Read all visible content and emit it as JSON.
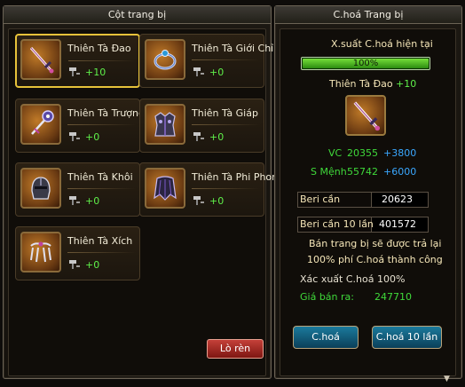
{
  "left_panel": {
    "title": "Cột trang bị",
    "slots": [
      {
        "name": "Thiên Tà Đao",
        "level": "+10",
        "icon": "saber-icon",
        "selected": true
      },
      {
        "name": "Thiên Tà Giới Chỉ",
        "level": "+0",
        "icon": "ring-icon",
        "selected": false
      },
      {
        "name": "Thiên Tà Trượng",
        "level": "+0",
        "icon": "staff-icon",
        "selected": false
      },
      {
        "name": "Thiên Tà Giáp",
        "level": "+0",
        "icon": "armor-icon",
        "selected": false
      },
      {
        "name": "Thiên Tà Khôi",
        "level": "+0",
        "icon": "helmet-icon",
        "selected": false
      },
      {
        "name": "Thiên Tà Phi Phong",
        "level": "+0",
        "icon": "cape-icon",
        "selected": false
      },
      {
        "name": "Thiên Tà Xích",
        "level": "+0",
        "icon": "claw-chain-icon",
        "selected": false
      }
    ],
    "forge_button": "Lò rèn"
  },
  "right_panel": {
    "title": "C.hoá Trang bị",
    "success_rate_label": "X.suất C.hoá hiện tại",
    "success_rate_value": "100%",
    "success_rate_fraction": 1.0,
    "selected_item_name": "Thiên Tà Đao",
    "selected_item_level": "+10",
    "selected_item_icon": "saber-icon",
    "stat1_name": "VC",
    "stat1_value": "20355",
    "stat1_bonus": "+3800",
    "stat2_name": "S Mệnh",
    "stat2_value": "55742",
    "stat2_bonus": "+6000",
    "cost_label": "Beri cần",
    "cost_value": "20623",
    "cost10_label": "Beri cần 10 lần",
    "cost10_value": "401572",
    "refund_line1": "Bán trang bị sẽ được trả lại",
    "refund_line2": "100% phí C.hoá thành công",
    "rate_text": "Xác xuất C.hoá 100%",
    "sell_label": "Giá bán ra:",
    "sell_value": "247710",
    "btn_once": "C.hoá",
    "btn_ten": "C.hoá 10 lần"
  },
  "colors": {
    "green": "#5ff04a",
    "stat_green": "#3fd93a",
    "stat_blue": "#3aa8ff",
    "gold": "#e6c23a",
    "cream": "#f5e6b8"
  }
}
